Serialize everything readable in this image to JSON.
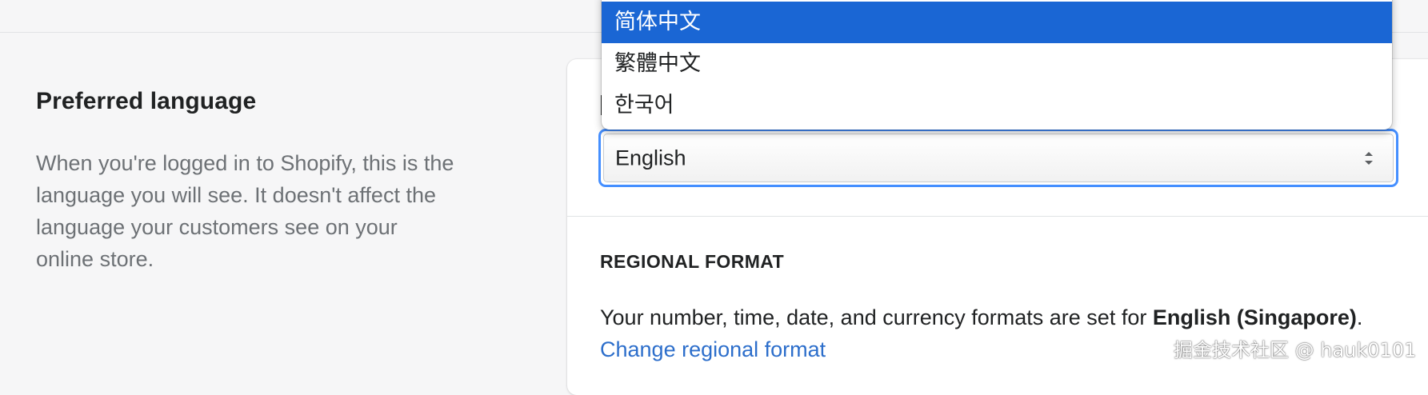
{
  "preferred_language": {
    "heading": "Preferred language",
    "description": "When you're logged in to Shopify, this is the language you will see. It doesn't affect the language your customers see on your online store."
  },
  "language_select": {
    "selected_value": "English",
    "options": [
      "简体中文",
      "繁體中文",
      "한국어"
    ],
    "highlighted_option": "简体中文"
  },
  "regional_format": {
    "heading": "REGIONAL FORMAT",
    "description_prefix": "Your number, time, date, and currency formats are set for ",
    "locale": "English (Singapore)",
    "description_suffix": ".",
    "change_link": "Change regional format"
  },
  "watermark": "掘金技术社区 @ hauk0101",
  "colors": {
    "background": "#f6f6f7",
    "card": "#ffffff",
    "focus_ring": "#458fff",
    "selected_option": "#1a66d4",
    "link": "#2c6ecb",
    "muted_text": "#6d7175"
  },
  "icons": {
    "select_arrow": "select-arrows-icon"
  }
}
